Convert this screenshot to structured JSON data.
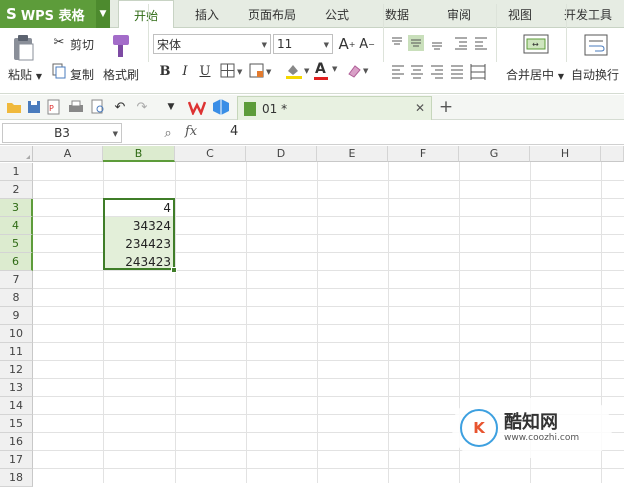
{
  "app": {
    "name": "WPS 表格",
    "logo": "S"
  },
  "menu": {
    "tabs": [
      "开始",
      "插入",
      "页面布局",
      "公式",
      "数据",
      "审阅",
      "视图",
      "开发工具"
    ],
    "active": "开始"
  },
  "ribbon": {
    "paste_label": "粘贴",
    "cut_label": "剪切",
    "copy_label": "复制",
    "format_painter_label": "格式刷",
    "font_name": "宋体",
    "font_size": "11",
    "grow_font": "A",
    "shrink_font": "A",
    "bold": "B",
    "italic": "I",
    "underline": "U",
    "font_color_glyph": "A",
    "merge_center_label": "合并居中",
    "wrap_text_label": "自动换行"
  },
  "document": {
    "tab_label": "01 *"
  },
  "formula_bar": {
    "name_box": "B3",
    "fx": "fx",
    "value": "4"
  },
  "grid": {
    "columns": [
      "A",
      "B",
      "C",
      "D",
      "E",
      "F",
      "G",
      "H"
    ],
    "rows": [
      "1",
      "2",
      "3",
      "4",
      "5",
      "6",
      "7",
      "8",
      "9",
      "10",
      "11",
      "12",
      "13",
      "14",
      "15",
      "16",
      "17",
      "18"
    ],
    "cells": {
      "B3": "4",
      "B4": "34324",
      "B5": "234423",
      "B6": "243423"
    },
    "selection": "B3:B6"
  },
  "watermark": {
    "logo": "K",
    "title": "酷知网",
    "url": "www.coozhi.com"
  },
  "colors": {
    "accent": "#5d9c3a",
    "selection_border": "#3f7d28",
    "selection_fill": "#e3efd9"
  }
}
